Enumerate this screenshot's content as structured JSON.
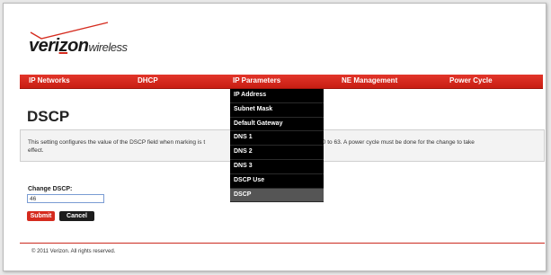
{
  "header": {
    "logo": {
      "brand_prefix": "veri",
      "brand_z": "z",
      "brand_suffix": "on",
      "brand_sub": "wireless"
    }
  },
  "nav": {
    "items": [
      "IP Networks",
      "DHCP",
      "IP Parameters",
      "NE Management",
      "Power Cycle"
    ],
    "dropdown": {
      "items": [
        "IP Address",
        "Subnet Mask",
        "Default Gateway",
        "DNS 1",
        "DNS 2",
        "DNS 3",
        "DSCP Use",
        "DSCP"
      ],
      "active_item": "DSCP"
    }
  },
  "main": {
    "title": "DSCP",
    "info": {
      "text_left": "This setting configures the value of the DSCP field when marking is t",
      "text_right": "value is from 0 to 63. A power cycle must be done for the change to take",
      "text_line2": "effect."
    },
    "field": {
      "label": "Change DSCP:",
      "value": "46"
    },
    "buttons": {
      "submit": "Submit",
      "cancel": "Cancel"
    }
  },
  "footer": {
    "copyright": "© 2011 Verizon. All rights reserved."
  },
  "colors": {
    "accent": "#d52b1e",
    "dropdown_bg": "#000000",
    "active_item_bg": "#555555"
  }
}
